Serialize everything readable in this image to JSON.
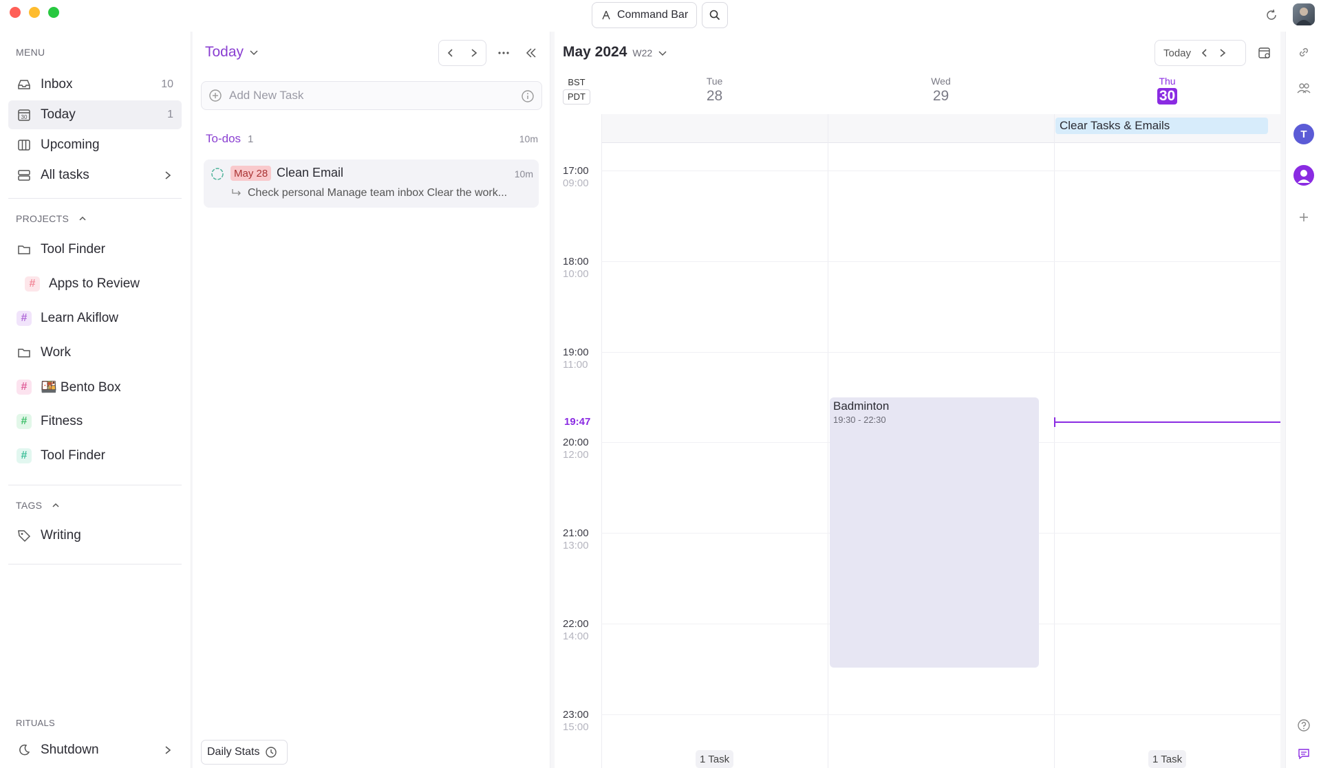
{
  "titlebar": {
    "command_bar_label": "Command Bar"
  },
  "sidebar": {
    "menu_label": "MENU",
    "items": [
      {
        "label": "Inbox",
        "count": "10"
      },
      {
        "label": "Today",
        "count": "1"
      },
      {
        "label": "Upcoming"
      },
      {
        "label": "All tasks"
      }
    ],
    "projects_label": "PROJECTS",
    "projects": [
      {
        "label": "Tool Finder",
        "type": "folder"
      },
      {
        "label": "Apps to Review",
        "type": "hash",
        "color": "#f28b9b"
      },
      {
        "label": "Learn Akiflow",
        "type": "hash",
        "color": "#b06ad8"
      },
      {
        "label": "Work",
        "type": "folder"
      },
      {
        "label": "🍱 Bento Box",
        "type": "hash",
        "color": "#e0609a"
      },
      {
        "label": "Fitness",
        "type": "hash",
        "color": "#3fbf6b"
      },
      {
        "label": "Tool Finder",
        "type": "hash",
        "color": "#3fbf9a"
      }
    ],
    "tags_label": "TAGS",
    "tags": [
      {
        "label": "Writing"
      }
    ],
    "rituals_label": "RITUALS",
    "rituals": [
      {
        "label": "Shutdown"
      }
    ]
  },
  "taskpanel": {
    "title": "Today",
    "add_task_placeholder": "Add New Task",
    "section_title": "To-dos",
    "section_count": "1",
    "section_duration": "10m",
    "tasks": [
      {
        "date": "May 28",
        "title": "Clean Email",
        "duration": "10m",
        "subtitle": "Check personal Manage team inbox Clear the work..."
      }
    ],
    "daily_stats_label": "Daily Stats"
  },
  "calendar": {
    "month_title": "May 2024",
    "week": "W22",
    "today_button": "Today",
    "tz_primary": "BST",
    "tz_secondary": "PDT",
    "days": [
      {
        "name": "Tue",
        "date": "28"
      },
      {
        "name": "Wed",
        "date": "29"
      },
      {
        "name": "Thu",
        "date": "30",
        "today": true
      }
    ],
    "allday_event": "Clear Tasks & Emails",
    "times": [
      {
        "main": "17:00",
        "sub": "09:00"
      },
      {
        "main": "18:00",
        "sub": "10:00"
      },
      {
        "main": "19:00",
        "sub": "11:00"
      },
      {
        "main": "20:00",
        "sub": "12:00"
      },
      {
        "main": "21:00",
        "sub": "13:00"
      },
      {
        "main": "22:00",
        "sub": "14:00"
      },
      {
        "main": "23:00",
        "sub": "15:00"
      }
    ],
    "now_label": "19:47",
    "event": {
      "title": "Badminton",
      "time": "19:30 - 22:30"
    },
    "task_counts": [
      "1 Task",
      "1 Task"
    ]
  },
  "colors": {
    "accent": "#8a2be2",
    "today_badge": "#8a2be2",
    "avatar_t": "#5b5bd6"
  },
  "rail": {
    "avatar_letter": "T"
  }
}
